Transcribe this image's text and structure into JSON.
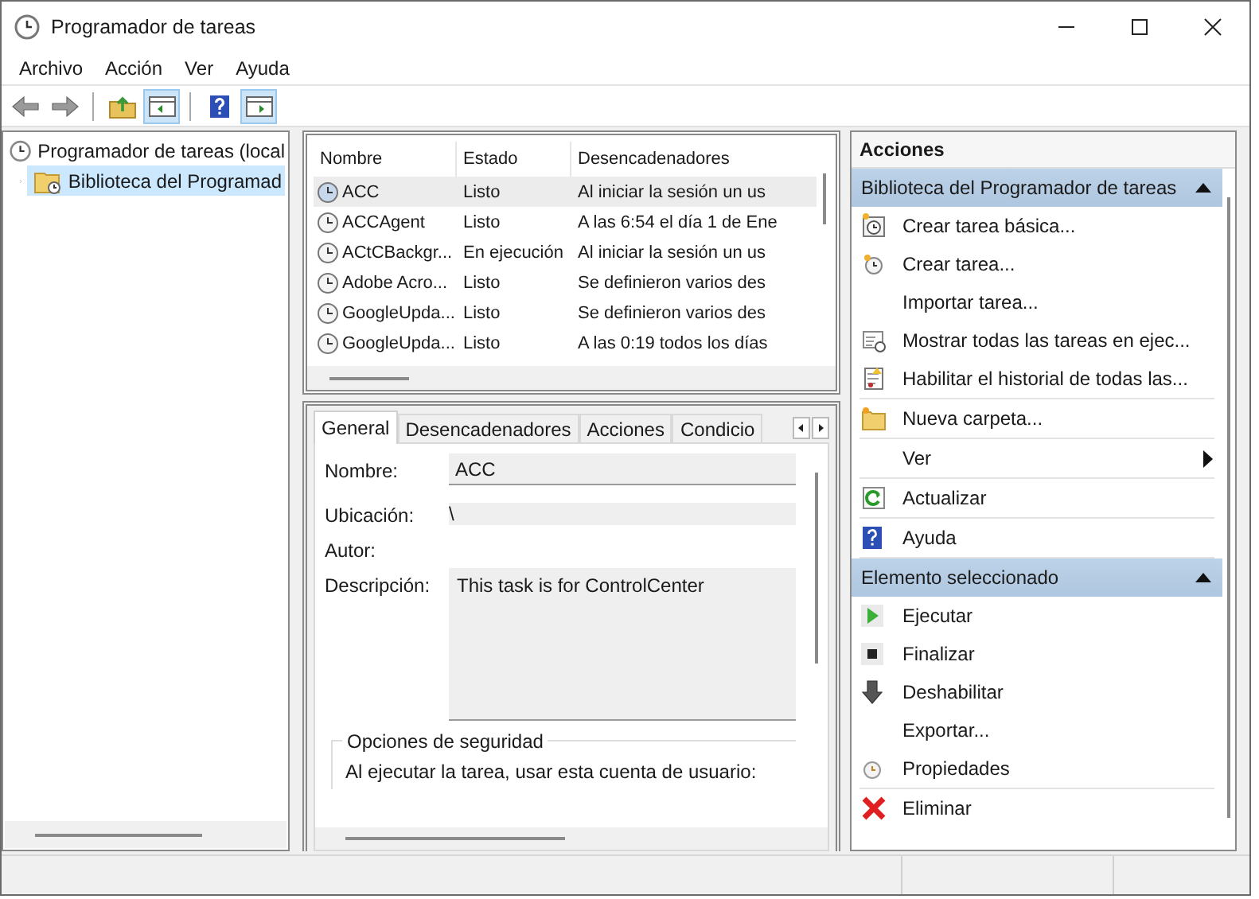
{
  "window": {
    "title": "Programador de tareas"
  },
  "menu": [
    {
      "label": "Archivo"
    },
    {
      "label": "Acción"
    },
    {
      "label": "Ver"
    },
    {
      "label": "Ayuda"
    }
  ],
  "toolbar": [
    {
      "kind": "back",
      "disabled": true,
      "pressed": false
    },
    {
      "kind": "forward",
      "disabled": true,
      "pressed": false
    },
    {
      "kind": "up",
      "pressed": false
    },
    {
      "kind": "tree",
      "pressed": true
    },
    {
      "kind": "help",
      "pressed": false
    },
    {
      "kind": "actions",
      "pressed": true
    }
  ],
  "tree": {
    "label": "Programador de tareas (local",
    "selected": false,
    "children": [
      {
        "label": "Biblioteca del Programad",
        "selected": true,
        "expanded": false
      }
    ]
  },
  "task_table": {
    "columns": [
      "Nombre",
      "Estado",
      "Desencadenadores"
    ],
    "rows": [
      {
        "name": "ACC",
        "status": "Listo",
        "triggers": "Al iniciar la sesión un us",
        "selected": true
      },
      {
        "name": "ACCAgent",
        "status": "Listo",
        "triggers": "A las 6:54 el día 1 de Ene",
        "selected": false
      },
      {
        "name": "ACtCBackgr...",
        "status": "En ejecución",
        "triggers": "Al iniciar la sesión un us",
        "selected": false
      },
      {
        "name": "Adobe Acro...",
        "status": "Listo",
        "triggers": "Se definieron varios des",
        "selected": false
      },
      {
        "name": "GoogleUpda...",
        "status": "Listo",
        "triggers": "Se definieron varios des",
        "selected": false
      },
      {
        "name": "GoogleUpda...",
        "status": "Listo",
        "triggers": "A las 0:19 todos los días",
        "selected": false
      }
    ]
  },
  "detail": {
    "tabs": [
      {
        "label": "General",
        "selected": true
      },
      {
        "label": "Desencadenadores",
        "selected": false
      },
      {
        "label": "Acciones",
        "selected": false
      },
      {
        "label": "Condicio",
        "selected": false
      }
    ],
    "fields": [
      {
        "label": "Nombre:",
        "value": "ACC",
        "kind": "field"
      },
      {
        "label": "Ubicación:",
        "value": "\\",
        "kind": "readonly"
      },
      {
        "label": "Autor:",
        "kind": "text"
      },
      {
        "label": "Descripción:",
        "value": "This task is for ControlCenter",
        "kind": "textarea"
      }
    ],
    "security": {
      "title": "Opciones de seguridad",
      "text": "Al ejecutar la tarea, usar esta cuenta de usuario:"
    }
  },
  "actions": {
    "title": "Acciones",
    "sections": [
      {
        "title": "Biblioteca del Programador de tareas",
        "expanded": true,
        "groups": [
          [
            {
              "label": "Crear tarea básica...",
              "kind": "action"
            },
            {
              "label": "Crear tarea...",
              "kind": "action"
            },
            {
              "label": "Importar tarea...",
              "kind": "action"
            },
            {
              "label": "Mostrar todas las tareas en ejec...",
              "kind": "action"
            },
            {
              "label": "Habilitar el historial de todas las...",
              "kind": "action"
            }
          ],
          [
            {
              "label": "Nueva carpeta...",
              "kind": "action"
            }
          ],
          [
            {
              "label": "Ver",
              "kind": "submenu"
            }
          ],
          [
            {
              "label": "Actualizar",
              "kind": "action"
            }
          ],
          [
            {
              "label": "Ayuda",
              "kind": "action"
            }
          ]
        ]
      },
      {
        "title": "Elemento seleccionado",
        "expanded": true,
        "groups": [
          [
            {
              "label": "Ejecutar",
              "kind": "action"
            },
            {
              "label": "Finalizar",
              "kind": "action"
            },
            {
              "label": "Deshabilitar",
              "kind": "action"
            },
            {
              "label": "Exportar...",
              "kind": "action"
            },
            {
              "label": "Propiedades",
              "kind": "action"
            }
          ],
          [
            {
              "label": "Eliminar",
              "kind": "action"
            }
          ]
        ]
      }
    ]
  }
}
